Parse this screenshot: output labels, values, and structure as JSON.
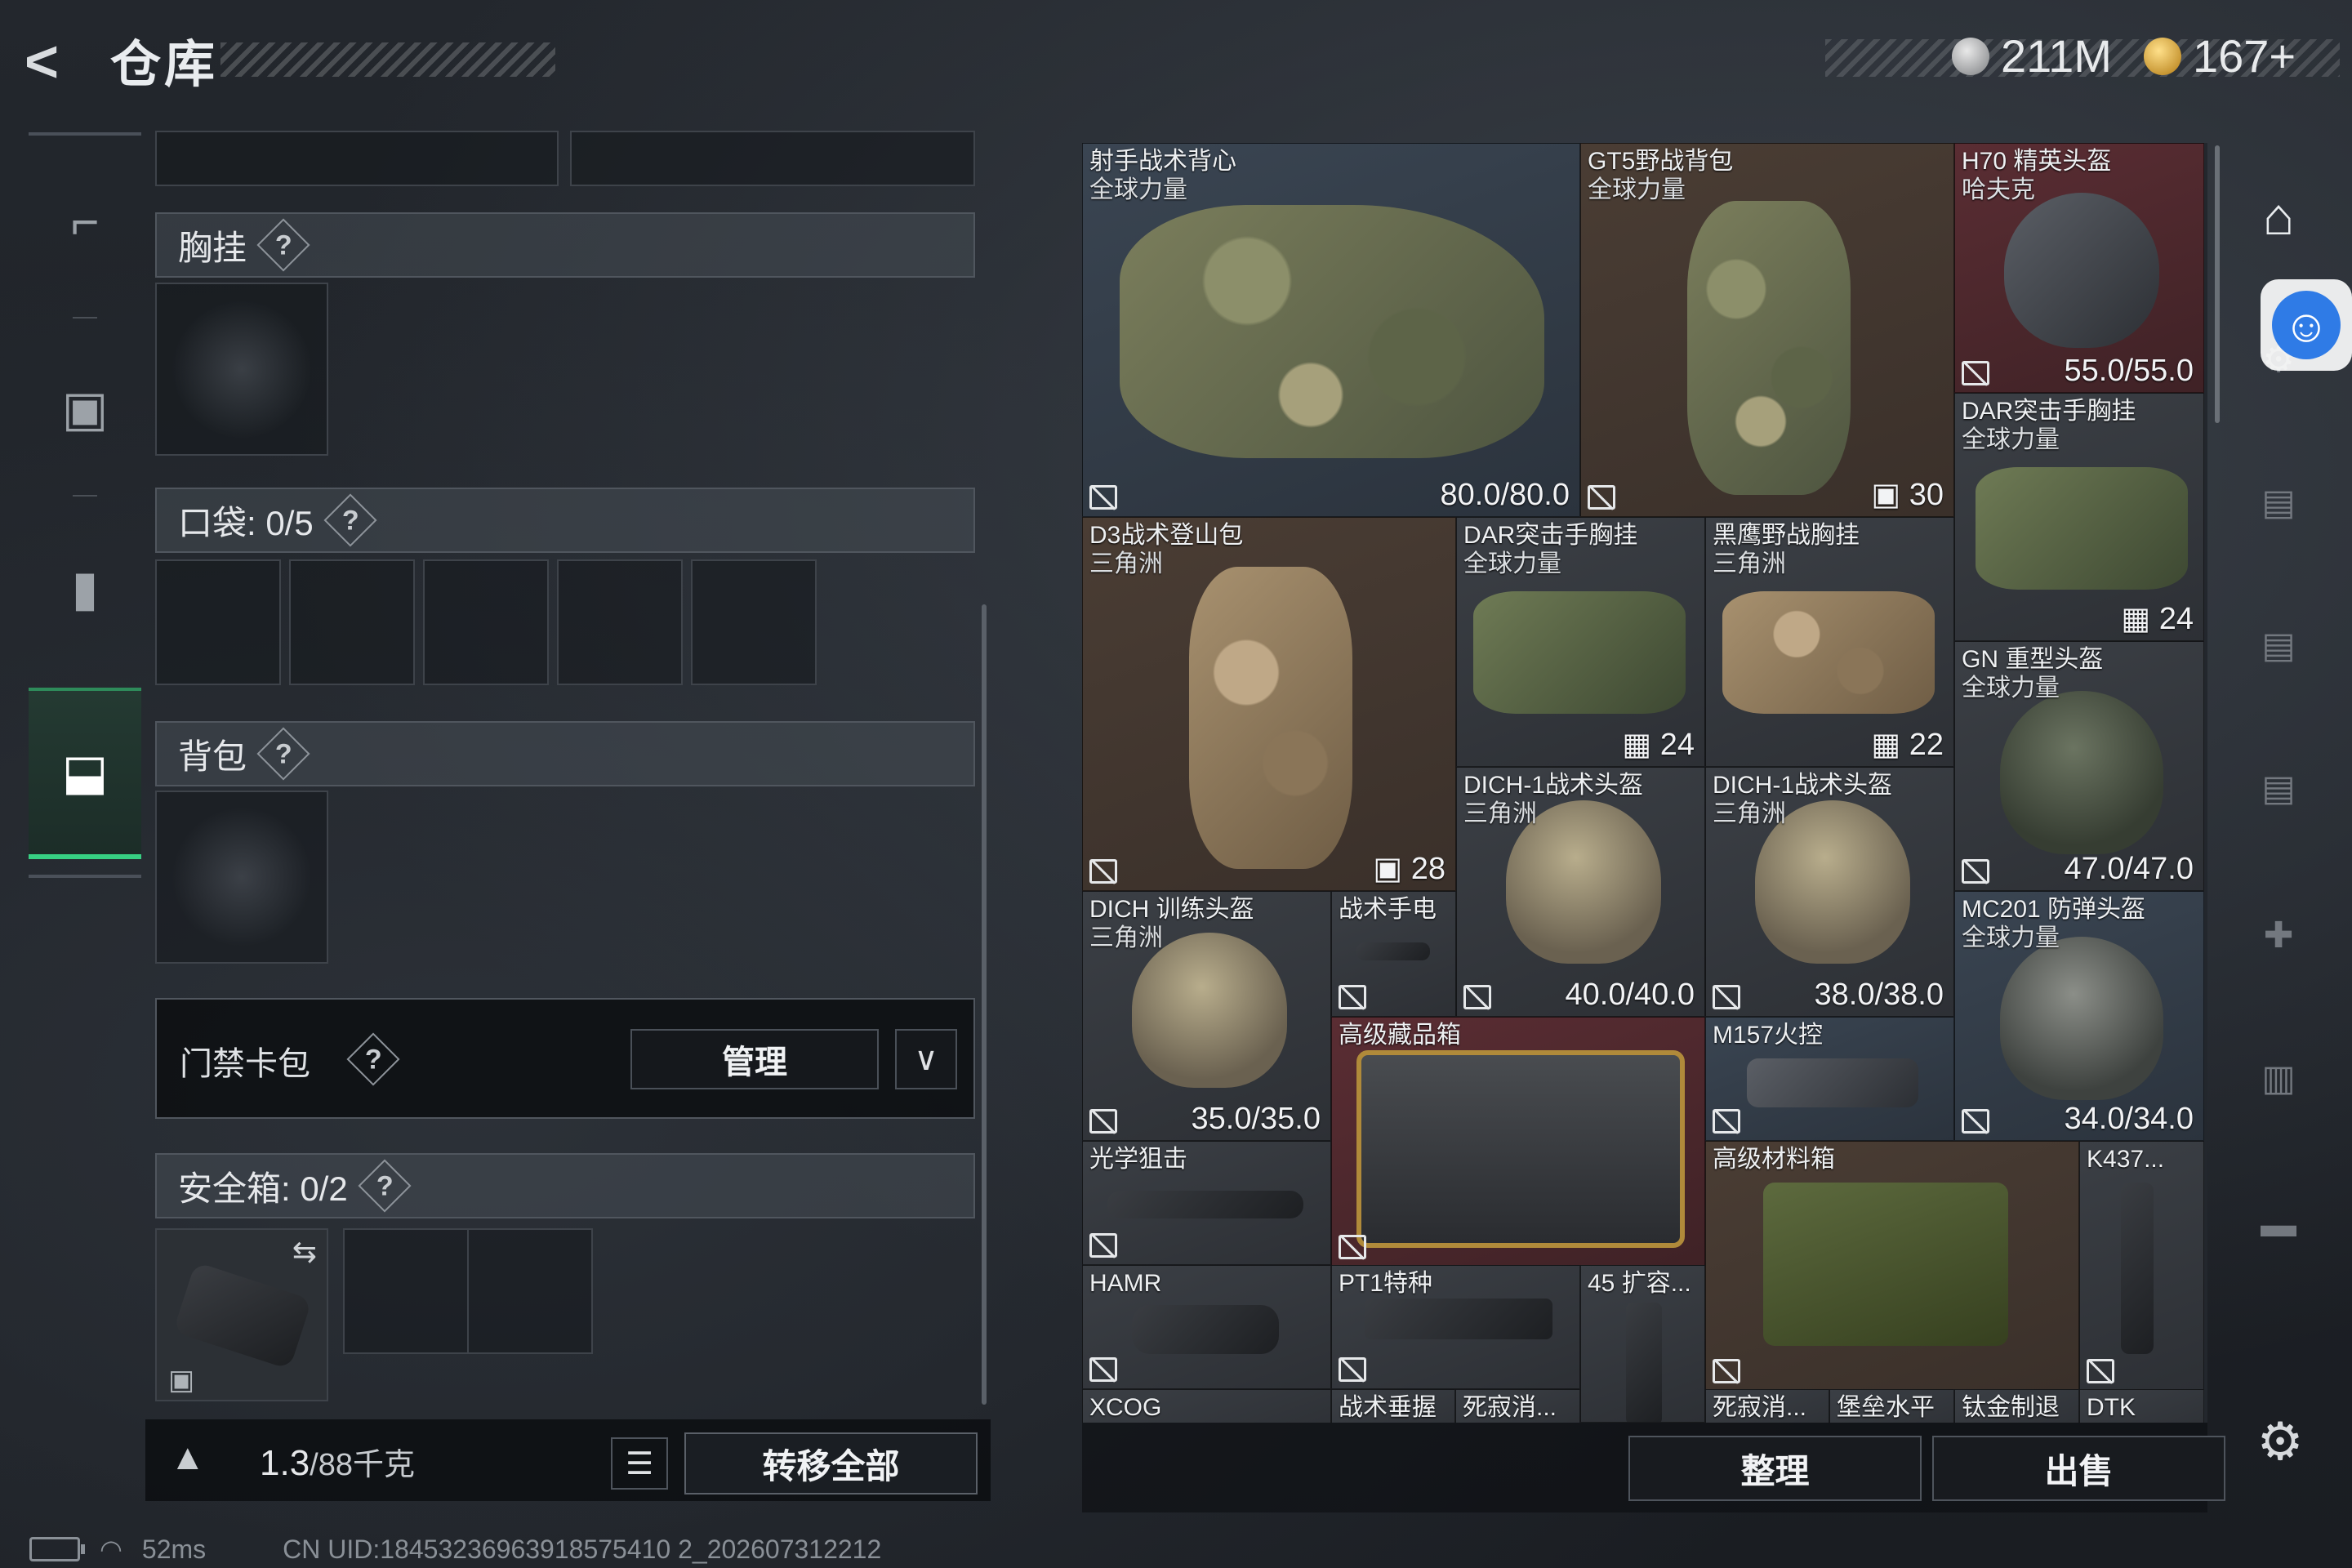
{
  "header": {
    "back_icon": "back-arrow-icon",
    "title": "仓库"
  },
  "currencies": [
    {
      "icon": "silver-coin-icon",
      "value": "211M"
    },
    {
      "icon": "gold-coin-icon",
      "value": "167+"
    }
  ],
  "nav": [
    {
      "icon": "rifle-icon",
      "active": false
    },
    {
      "icon": "vest-icon",
      "active": false
    },
    {
      "icon": "backpack-icon",
      "active": false
    },
    {
      "icon": "toolbox-icon",
      "active": true
    }
  ],
  "equipment": {
    "chest_rig": {
      "label": "胸挂",
      "help": "?"
    },
    "pockets": {
      "label": "口袋: 0/5",
      "help": "?"
    },
    "backpack": {
      "label": "背包",
      "help": "?"
    },
    "keycard": {
      "label": "门禁卡包",
      "help": "?",
      "manage": "管理"
    },
    "safebox": {
      "label": "安全箱: 0/2",
      "help": "?"
    }
  },
  "footer_left": {
    "weight": "1.3",
    "weight_max": "/88千克",
    "transfer_all": "转移全部"
  },
  "footer_right": {
    "sort": "整理",
    "sell": "出售"
  },
  "status_bar": {
    "ping": "52ms",
    "uid": "CN UID:18453236963918575410 2_202607312212"
  },
  "accent_colors": {
    "active_nav": "#37d083",
    "tile_red": "#5a2d33",
    "tile_blue": "#3a4552",
    "tile_brown": "#4a3d34",
    "access_button": "#2f7be6"
  },
  "items": [
    {
      "name": "射手战术背心",
      "sub": "全球力量",
      "value": "80.0/80.0"
    },
    {
      "name": "GT5野战背包",
      "sub": "全球力量",
      "value": "30"
    },
    {
      "name": "H70 精英头盔",
      "sub": "哈夫克",
      "value": "55.0/55.0"
    },
    {
      "name": "DAR突击手胸挂",
      "sub": "全球力量",
      "value": "24"
    },
    {
      "name": "D3战术登山包",
      "sub": "三角洲",
      "value": "28"
    },
    {
      "name": "DAR突击手胸挂",
      "sub": "全球力量",
      "value": "24"
    },
    {
      "name": "黑鹰野战胸挂",
      "sub": "三角洲",
      "value": "22"
    },
    {
      "name": "GN 重型头盔",
      "sub": "全球力量",
      "value": "47.0/47.0"
    },
    {
      "name": "DICH-1战术头盔",
      "sub": "三角洲",
      "value": "40.0/40.0"
    },
    {
      "name": "DICH-1战术头盔",
      "sub": "三角洲",
      "value": "38.0/38.0"
    },
    {
      "name": "DICH 训练头盔",
      "sub": "三角洲",
      "value": "35.0/35.0"
    },
    {
      "name": "战术手电",
      "sub": "",
      "value": ""
    },
    {
      "name": "MC201 防弹头盔",
      "sub": "全球力量",
      "value": "34.0/34.0"
    },
    {
      "name": "高级藏品箱",
      "sub": "",
      "value": ""
    },
    {
      "name": "M157火控",
      "sub": "",
      "value": ""
    },
    {
      "name": "光学狙击",
      "sub": "",
      "value": ""
    },
    {
      "name": "高级材料箱",
      "sub": "",
      "value": ""
    },
    {
      "name": "K437...",
      "sub": "",
      "value": ""
    },
    {
      "name": "HAMR",
      "sub": "",
      "value": ""
    },
    {
      "name": "PT1特种",
      "sub": "",
      "value": ""
    },
    {
      "name": "45 扩容...",
      "sub": "",
      "value": ""
    },
    {
      "name": "XCOG",
      "sub": "",
      "value": ""
    },
    {
      "name": "战术垂握",
      "sub": "",
      "value": ""
    },
    {
      "name": "死寂消...",
      "sub": "",
      "value": ""
    },
    {
      "name": "死寂消...",
      "sub": "",
      "value": ""
    },
    {
      "name": "堡垒水平",
      "sub": "",
      "value": ""
    },
    {
      "name": "钛金制退",
      "sub": "",
      "value": ""
    },
    {
      "name": "DTK",
      "sub": "",
      "value": ""
    }
  ]
}
